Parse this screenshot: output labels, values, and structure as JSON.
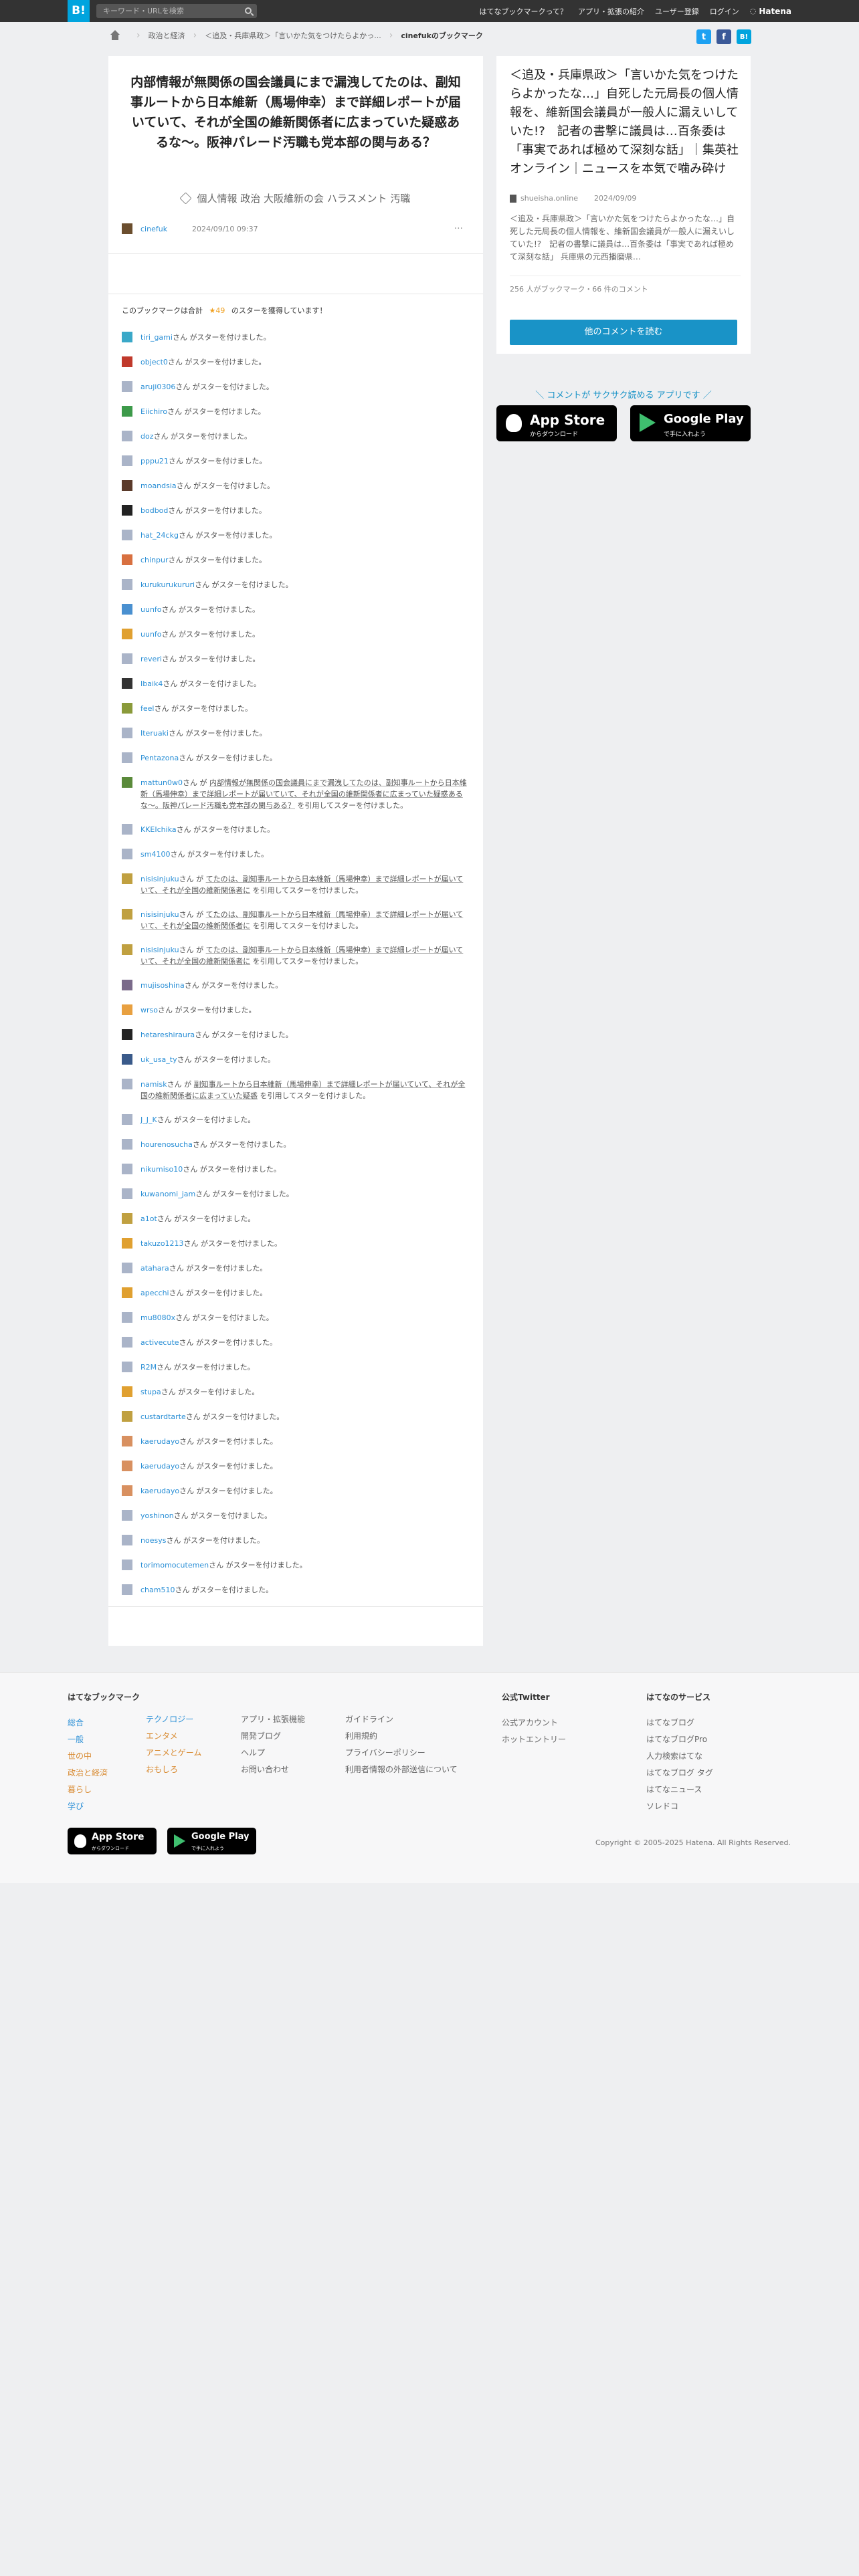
{
  "header": {
    "logo": "B!",
    "search_placeholder": "キーワード・URLを検索",
    "nav": [
      "はてなブックマークって？",
      "アプリ・拡張の紹介",
      "ユーザー登録",
      "ログイン"
    ],
    "hatena": "Hatena"
  },
  "breadcrumb": {
    "items": [
      "政治と経済",
      "＜追及・兵庫県政＞「言いかた気をつけたらよかっ..."
    ],
    "current": "cinefukのブックマーク"
  },
  "share": {
    "twitter": "t",
    "facebook": "f",
    "hatebu": "B!"
  },
  "entry": {
    "comment": "内部情報が無関係の国会議員にまで漏洩してたのは、副知事ルートから日本維新（馬場伸幸）まで詳細レポートが届いていて、それが全国の維新関係者に広まっていた疑惑あるな〜。阪神パレード汚職も党本部の関与ある？",
    "tags": [
      "個人情報",
      "政治",
      "大阪維新の会",
      "ハラスメント",
      "汚職"
    ],
    "user": "cinefuk",
    "timestamp": "2024/09/10 09:37",
    "more": "···"
  },
  "stars": {
    "summary_prefix": "このブックマークは合計",
    "count": "★49",
    "summary_suffix": "のスターを獲得しています！",
    "suffix_plain": "さん がスターを付けました。",
    "suffix_quote_pre": "さん が",
    "suffix_quote_post": "を引用してスターを付けました。",
    "list": [
      {
        "user": "tiri_gami",
        "color": "#3aa8c8"
      },
      {
        "user": "object0",
        "color": "#c0392b"
      },
      {
        "user": "aruji0306",
        "color": "#aab4c8"
      },
      {
        "user": "Eiichiro",
        "color": "#3d9a4a"
      },
      {
        "user": "doz",
        "color": "#aab4c8"
      },
      {
        "user": "pppu21",
        "color": "#aab4c8"
      },
      {
        "user": "moandsia",
        "color": "#5a3a2a"
      },
      {
        "user": "bodbod",
        "color": "#222"
      },
      {
        "user": "hat_24ckg",
        "color": "#aab4c8"
      },
      {
        "user": "chinpur",
        "color": "#d87040"
      },
      {
        "user": "kurukurukururi",
        "color": "#aab4c8"
      },
      {
        "user": "uunfo",
        "color": "#4a90d0"
      },
      {
        "user": "uunfo",
        "color": "#e0a030"
      },
      {
        "user": "reveri",
        "color": "#aab4c8"
      },
      {
        "user": "Ibaik4",
        "color": "#333"
      },
      {
        "user": "feel",
        "color": "#8a9a3a"
      },
      {
        "user": "Iteruaki",
        "color": "#aab4c8"
      },
      {
        "user": "Pentazona",
        "color": "#aab4c8"
      },
      {
        "user": "mattun0w0",
        "color": "#5a8a3a",
        "quote": "内部情報が無関係の国会議員にまで漏洩してたのは、副知事ルートから日本維新（馬場伸幸）まで詳細レポートが届いていて、それが全国の維新関係者に広まっていた疑惑あるな〜。阪神パレード汚職も党本部の関与ある？"
      },
      {
        "user": "KKEIchika",
        "color": "#aab4c8"
      },
      {
        "user": "sm4100",
        "color": "#aab4c8"
      },
      {
        "user": "nisisinjuku",
        "color": "#c0a040",
        "quote": "てたのは、副知事ルートから日本維新（馬場伸幸）まで詳細レポートが届いていて、それが全国の維新関係者に"
      },
      {
        "user": "nisisinjuku",
        "color": "#c0a040",
        "quote": "てたのは、副知事ルートから日本維新（馬場伸幸）まで詳細レポートが届いていて、それが全国の維新関係者に"
      },
      {
        "user": "nisisinjuku",
        "color": "#c0a040",
        "quote": "てたのは、副知事ルートから日本維新（馬場伸幸）まで詳細レポートが届いていて、それが全国の維新関係者に"
      },
      {
        "user": "mujisoshina",
        "color": "#7a6a8a"
      },
      {
        "user": "wrso",
        "color": "#e8a040"
      },
      {
        "user": "hetareshiraura",
        "color": "#222"
      },
      {
        "user": "uk_usa_ty",
        "color": "#3a5a8a"
      },
      {
        "user": "namisk",
        "color": "#aab4c8",
        "quote": "副知事ルートから日本維新（馬場伸幸）まで詳細レポートが届いていて、それが全国の維新関係者に広まっていた疑惑"
      },
      {
        "user": "J_J_K",
        "color": "#aab4c8"
      },
      {
        "user": "hourenosucha",
        "color": "#aab4c8"
      },
      {
        "user": "nikumiso10",
        "color": "#aab4c8"
      },
      {
        "user": "kuwanomi_jam",
        "color": "#aab4c8"
      },
      {
        "user": "a1ot",
        "color": "#c0a040"
      },
      {
        "user": "takuzo1213",
        "color": "#e0a030"
      },
      {
        "user": "atahara",
        "color": "#aab4c8"
      },
      {
        "user": "apecchi",
        "color": "#e0a030"
      },
      {
        "user": "mu8080x",
        "color": "#aab4c8"
      },
      {
        "user": "activecute",
        "color": "#aab4c8"
      },
      {
        "user": "R2M",
        "color": "#aab4c8"
      },
      {
        "user": "stupa",
        "color": "#e0a030"
      },
      {
        "user": "custardtarte",
        "color": "#c0a040"
      },
      {
        "user": "kaerudayo",
        "color": "#d89060"
      },
      {
        "user": "kaerudayo",
        "color": "#d89060"
      },
      {
        "user": "kaerudayo",
        "color": "#d89060"
      },
      {
        "user": "yoshinon",
        "color": "#aab4c8"
      },
      {
        "user": "noesys",
        "color": "#aab4c8"
      },
      {
        "user": "torimomocutemen",
        "color": "#aab4c8"
      },
      {
        "user": "cham510",
        "color": "#aab4c8"
      }
    ]
  },
  "article": {
    "title": "＜追及・兵庫県政＞「言いかた気をつけたらよかったな…」自死した元局長の個人情報を、維新国会議員が一般人に漏えいしていた!?　記者の書撃に議員は…百条委は「事実であれば極めて深刻な話」｜集英社オンライン｜ニュースを本気で噛み砕け",
    "publisher": "shueisha.online",
    "date": "2024/09/09",
    "description": "＜追及・兵庫県政＞「言いかた気をつけたらよかったな…」自死した元局長の個人情報を、維新国会議員が一般人に漏えいしていた!?　記者の書撃に議員は…百条委は「事実であれば極めて深刻な話」 兵庫県の元西播磨県…",
    "stats": "256 人がブックマーク・66 件のコメント",
    "button": "他のコメントを読む"
  },
  "app_promo": {
    "message": "＼ コメントが サクサク読める アプリです ／",
    "appstore_line1": "App Store",
    "appstore_line2": "からダウンロード",
    "googleplay_line1": "Google Play",
    "googleplay_line2": "で手に入れよう"
  },
  "footer": {
    "col1": {
      "heading": "はてなブックマーク",
      "links": [
        "総合",
        "一般",
        "世の中",
        "政治と経済",
        "暮らし",
        "学び"
      ]
    },
    "col2": {
      "links": [
        "テクノロジー",
        "エンタメ",
        "アニメとゲーム",
        "おもしろ"
      ]
    },
    "col3": {
      "links": [
        "アプリ・拡張機能",
        "開発ブログ",
        "ヘルプ",
        "お問い合わせ"
      ]
    },
    "col4": {
      "links": [
        "ガイドライン",
        "利用規約",
        "プライバシーポリシー",
        "利用者情報の外部送信について"
      ]
    },
    "col5": {
      "heading": "公式Twitter",
      "links": [
        "公式アカウント",
        "ホットエントリー"
      ]
    },
    "col6": {
      "heading": "はてなのサービス",
      "links": [
        "はてなブログ",
        "はてなブログPro",
        "人力検索はてな",
        "はてなブログ タグ",
        "はてなニュース",
        "ソレドコ"
      ]
    },
    "appstore_line1": "App Store",
    "appstore_line2": "からダウンロード",
    "googleplay_line1": "Google Play",
    "googleplay_line2": "で手に入れよう",
    "copyright": "Copyright © 2005-2025 Hatena. All Rights Reserved."
  }
}
